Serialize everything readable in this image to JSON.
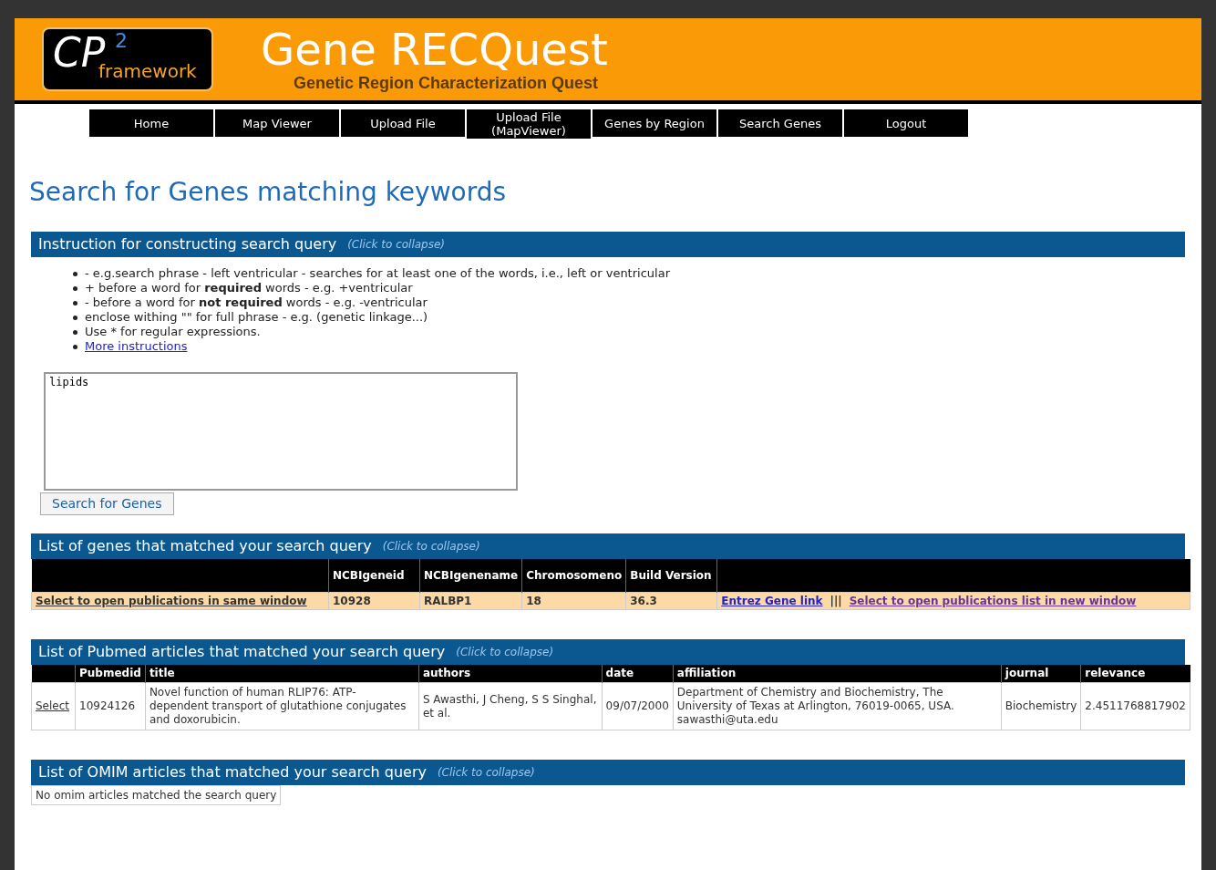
{
  "header": {
    "logo": {
      "main": "CP",
      "sup": "2",
      "sub": "framework"
    },
    "title": "Gene RECQuest",
    "subtitle": "Genetic Region Characterization Quest"
  },
  "nav": [
    {
      "label": "Home"
    },
    {
      "label": "Map Viewer"
    },
    {
      "label": "Upload File"
    },
    {
      "label": "Upload File (MapViewer)"
    },
    {
      "label": "Genes by Region"
    },
    {
      "label": "Search Genes"
    },
    {
      "label": "Logout"
    }
  ],
  "page_title": "Search for Genes matching keywords",
  "instructions": {
    "title": "Instruction for constructing search query",
    "toggle": "(Click to collapse)",
    "items": [
      {
        "kind": "text",
        "text": "-  e.g.search phrase  - left ventricular  - searches for at least one of  the words, i.e., left or ventricular"
      },
      {
        "kind": "text",
        "text": "+ before a word for **required** words - e.g.  +ventricular"
      },
      {
        "kind": "text",
        "text": "- before a word for **not required** words - e.g. -ventricular"
      },
      {
        "kind": "text",
        "text": "enclose withing \"\" for full phrase - e.g. (genetic linkage...)"
      },
      {
        "kind": "text",
        "text": "Use * for regular expressions."
      },
      {
        "kind": "link",
        "text": "More instructions"
      }
    ]
  },
  "query": {
    "value": "lipids",
    "button": "Search for Genes"
  },
  "genes": {
    "title": "List of genes that matched your search query",
    "toggle": "(Click to collapse)",
    "columns": [
      "NCBIgeneid",
      "NCBIgenename",
      "Chromosomeno",
      "Build Version"
    ],
    "rows": [
      {
        "select": "Select to open publications in same window",
        "cells": [
          "10928",
          "RALBP1",
          "18",
          "36.3"
        ],
        "entrez": "Entrez Gene link",
        "separator": "|||",
        "new_window": "Select to open publications list in new window"
      }
    ]
  },
  "pubmed": {
    "title": "List of Pubmed articles that matched your search query",
    "toggle": "(Click to collapse)",
    "columns": [
      "Pubmedid",
      "title",
      "authors",
      "date",
      "affiliation",
      "journal",
      "relevance"
    ],
    "rows": [
      {
        "select": "Select",
        "cells": [
          "10924126",
          "Novel function of human RLIP76: ATP-dependent transport of glutathione conjugates and doxorubicin.",
          "S Awasthi, J Cheng, S S Singhal, et al.",
          "09/07/2000",
          "Department of Chemistry and Biochemistry, The University of Texas at Arlington, 76019-0065, USA. sawasthi@uta.edu",
          "Biochemistry",
          "2.4511768817902"
        ]
      }
    ]
  },
  "omim": {
    "title": "List of OMIM articles that matched your search query",
    "toggle": "(Click to collapse)",
    "message": "No omim articles matched the search query"
  }
}
